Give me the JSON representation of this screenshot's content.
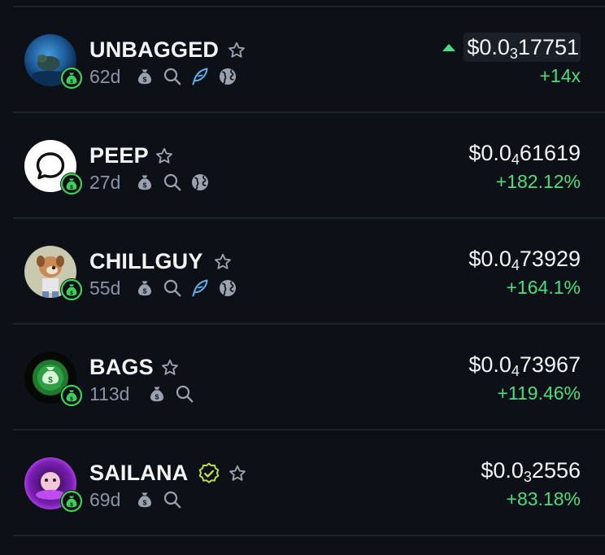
{
  "tokens": [
    {
      "name": "UNBAGGED",
      "age": "62d",
      "price_prefix": "$0.0",
      "price_zeros": "3",
      "price_digits": "17751",
      "change": "+14x",
      "icons": [
        "star-icon",
        "money-bag-icon",
        "search-icon",
        "feather-icon",
        "globe-icon"
      ],
      "trend": "up"
    },
    {
      "name": "PEEP",
      "age": "27d",
      "price_prefix": "$0.0",
      "price_zeros": "4",
      "price_digits": "61619",
      "change": "+182.12%",
      "icons": [
        "star-icon",
        "money-bag-icon",
        "search-icon",
        "globe-icon"
      ]
    },
    {
      "name": "CHILLGUY",
      "age": "55d",
      "price_prefix": "$0.0",
      "price_zeros": "4",
      "price_digits": "73929",
      "change": "+164.1%",
      "icons": [
        "star-icon",
        "money-bag-icon",
        "search-icon",
        "feather-icon",
        "globe-icon"
      ]
    },
    {
      "name": "BAGS",
      "age": "113d",
      "price_prefix": "$0.0",
      "price_zeros": "4",
      "price_digits": "73967",
      "change": "+119.46%",
      "icons": [
        "star-icon",
        "money-bag-icon",
        "search-icon"
      ]
    },
    {
      "name": "SAILANA",
      "age": "69d",
      "price_prefix": "$0.0",
      "price_zeros": "3",
      "price_digits": "2556",
      "change": "+83.18%",
      "verified": true,
      "icons": [
        "verified-badge-icon",
        "star-icon",
        "money-bag-icon",
        "search-icon"
      ]
    }
  ],
  "colors": {
    "background": "#0d1117",
    "positive": "#4ade80",
    "muted": "#8b93a4",
    "twitter_blue": "#5bb4f0",
    "verified_lime": "#b7e34a",
    "bag_badge_green": "#3fcf5a"
  }
}
